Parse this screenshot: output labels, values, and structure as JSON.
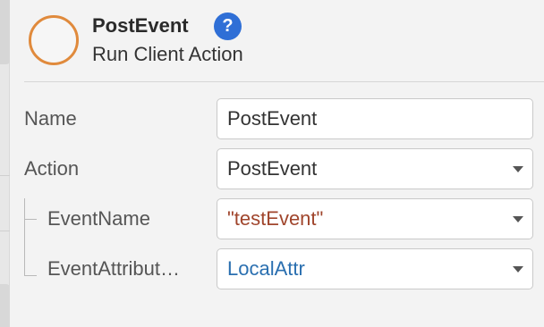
{
  "header": {
    "title": "PostEvent",
    "subtitle": "Run Client Action",
    "help_label": "?",
    "icon": "orange-circle-icon"
  },
  "properties": {
    "name": {
      "label": "Name",
      "value": "PostEvent"
    },
    "action": {
      "label": "Action",
      "value": "PostEvent"
    },
    "event_name": {
      "label": "EventName",
      "value": "\"testEvent\""
    },
    "event_attributes": {
      "label": "EventAttribut…",
      "value": "LocalAttr"
    }
  },
  "colors": {
    "ring": "#e08a3c",
    "help": "#2f6fd6",
    "string_value": "#a0452c",
    "variable_value": "#2a6fb0"
  }
}
